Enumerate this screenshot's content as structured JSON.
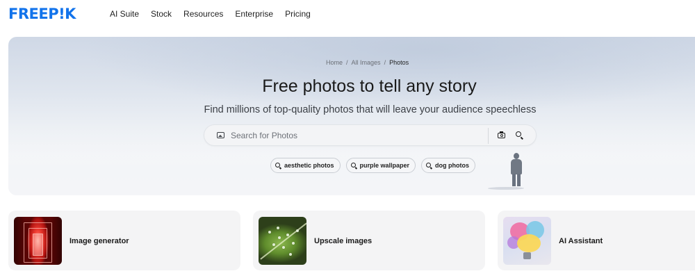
{
  "header": {
    "logo": "FREEP!K",
    "nav": [
      "AI Suite",
      "Stock",
      "Resources",
      "Enterprise",
      "Pricing"
    ]
  },
  "hero": {
    "breadcrumb": [
      "Home",
      "All Images",
      "Photos"
    ],
    "title": "Free photos to tell any story",
    "subtitle": "Find millions of top-quality photos that will leave your audience speechless",
    "search": {
      "placeholder": "Search for Photos",
      "value": ""
    },
    "suggestions": [
      "aesthetic photos",
      "purple wallpaper",
      "dog photos"
    ]
  },
  "cards": [
    {
      "title": "Image generator"
    },
    {
      "title": "Upscale images"
    },
    {
      "title": "AI Assistant"
    }
  ],
  "colors": {
    "brand": "#1273eb",
    "card_bg": "#f4f4f5"
  }
}
